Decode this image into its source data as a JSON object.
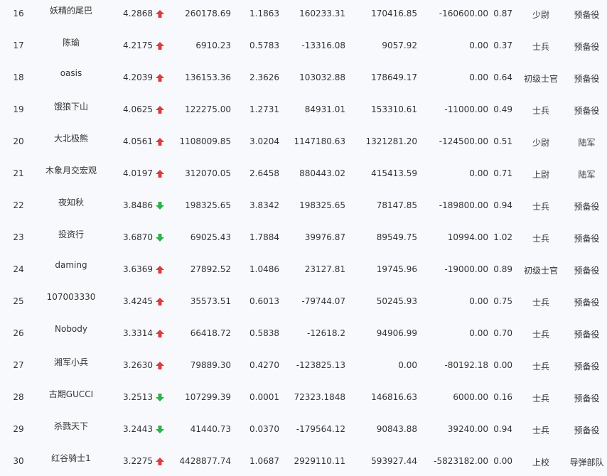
{
  "colors": {
    "up": "#e03b3b",
    "down": "#2bb24c"
  },
  "rows": [
    {
      "rank": "16",
      "name": "妖精的尾巴",
      "score": "4.2868",
      "trend": "up",
      "a": "260178.69",
      "b": "1.1863",
      "c": "160233.31",
      "d": "170416.85",
      "e": "-160600.00",
      "f": "0.87",
      "title": "少尉",
      "branch": "预备役"
    },
    {
      "rank": "17",
      "name": "陈瑜",
      "score": "4.2175",
      "trend": "up",
      "a": "6910.23",
      "b": "0.5783",
      "c": "-13316.08",
      "d": "9057.92",
      "e": "0.00",
      "f": "0.37",
      "title": "士兵",
      "branch": "预备役"
    },
    {
      "rank": "18",
      "name": "oasis",
      "score": "4.2039",
      "trend": "up",
      "a": "136153.36",
      "b": "2.3626",
      "c": "103032.88",
      "d": "178649.17",
      "e": "0.00",
      "f": "0.64",
      "title": "初级士官",
      "branch": "预备役"
    },
    {
      "rank": "19",
      "name": "饿狼下山",
      "score": "4.0625",
      "trend": "up",
      "a": "122275.00",
      "b": "1.2731",
      "c": "84931.01",
      "d": "153310.61",
      "e": "-11000.00",
      "f": "0.49",
      "title": "士兵",
      "branch": "预备役"
    },
    {
      "rank": "20",
      "name": "大北极熊",
      "score": "4.0561",
      "trend": "up",
      "a": "1108009.85",
      "b": "3.0204",
      "c": "1147180.63",
      "d": "1321281.20",
      "e": "-124500.00",
      "f": "0.51",
      "title": "少尉",
      "branch": "陆军"
    },
    {
      "rank": "21",
      "name": "木象月交宏观",
      "score": "4.0197",
      "trend": "up",
      "a": "312070.05",
      "b": "2.6458",
      "c": "880443.02",
      "d": "415413.59",
      "e": "0.00",
      "f": "0.71",
      "title": "上尉",
      "branch": "陆军"
    },
    {
      "rank": "22",
      "name": "夜知秋",
      "score": "3.8486",
      "trend": "down",
      "a": "198325.65",
      "b": "3.8342",
      "c": "198325.65",
      "d": "78147.85",
      "e": "-189800.00",
      "f": "0.94",
      "title": "士兵",
      "branch": "预备役"
    },
    {
      "rank": "23",
      "name": "投资行",
      "score": "3.6870",
      "trend": "down",
      "a": "69025.43",
      "b": "1.7884",
      "c": "39976.87",
      "d": "89549.75",
      "e": "10994.00",
      "f": "1.02",
      "title": "士兵",
      "branch": "预备役"
    },
    {
      "rank": "24",
      "name": "daming",
      "score": "3.6369",
      "trend": "up",
      "a": "27892.52",
      "b": "1.0486",
      "c": "23127.81",
      "d": "19745.96",
      "e": "-19000.00",
      "f": "0.89",
      "title": "初级士官",
      "branch": "预备役"
    },
    {
      "rank": "25",
      "name": "107003330",
      "score": "3.4245",
      "trend": "up",
      "a": "35573.51",
      "b": "0.6013",
      "c": "-79744.07",
      "d": "50245.93",
      "e": "0.00",
      "f": "0.75",
      "title": "士兵",
      "branch": "预备役"
    },
    {
      "rank": "26",
      "name": "Nobody",
      "score": "3.3314",
      "trend": "up",
      "a": "66418.72",
      "b": "0.5838",
      "c": "-12618.2",
      "d": "94906.99",
      "e": "0.00",
      "f": "0.70",
      "title": "士兵",
      "branch": "预备役"
    },
    {
      "rank": "27",
      "name": "湘军小兵",
      "score": "3.2630",
      "trend": "up",
      "a": "79889.30",
      "b": "0.4270",
      "c": "-123825.13",
      "d": "0.00",
      "e": "-80192.18",
      "f": "0.00",
      "title": "士兵",
      "branch": "预备役"
    },
    {
      "rank": "28",
      "name": "古期GUCCI",
      "score": "3.2513",
      "trend": "down",
      "a": "107299.39",
      "b": "0.0001",
      "c": "72323.1848",
      "d": "146816.63",
      "e": "6000.00",
      "f": "0.16",
      "title": "士兵",
      "branch": "预备役"
    },
    {
      "rank": "29",
      "name": "杀戮天下",
      "score": "3.2443",
      "trend": "down",
      "a": "41440.73",
      "b": "0.0370",
      "c": "-179564.12",
      "d": "90843.88",
      "e": "39240.00",
      "f": "0.94",
      "title": "士兵",
      "branch": "预备役"
    },
    {
      "rank": "30",
      "name": "红谷骑士1",
      "score": "3.2275",
      "trend": "up",
      "a": "4428877.74",
      "b": "1.0687",
      "c": "2929110.11",
      "d": "593927.44",
      "e": "-5823182.00",
      "f": "0.00",
      "title": "上校",
      "branch": "导弹部队"
    }
  ]
}
